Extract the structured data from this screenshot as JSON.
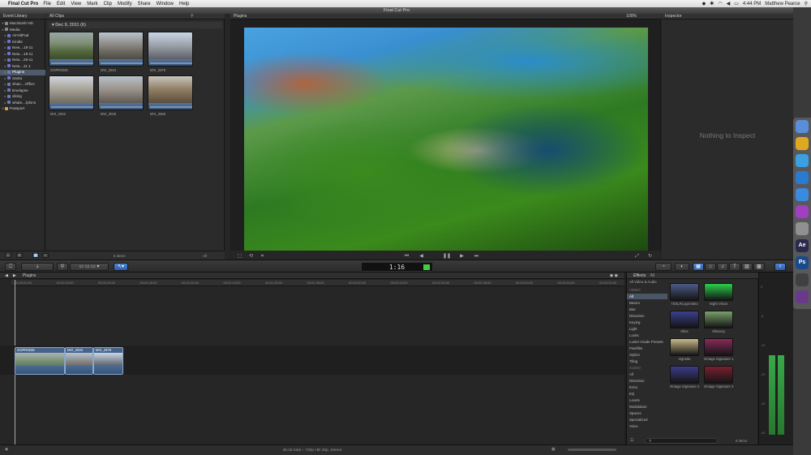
{
  "menubar": {
    "app_name": "Final Cut Pro",
    "items": [
      "File",
      "Edit",
      "View",
      "Mark",
      "Clip",
      "Modify",
      "Share",
      "Window",
      "Help"
    ],
    "time": "4:44 PM",
    "user": "Matthew Pearce"
  },
  "window_title": "Final Cut Pro",
  "event_library": {
    "title": "Event Library",
    "items": [
      {
        "label": "Macintosh HD",
        "icon": "disk-icon",
        "indent": 0,
        "selected": false
      },
      {
        "label": "Media",
        "icon": "disk-icon",
        "indent": 0,
        "selected": false
      },
      {
        "label": "AirVidPad",
        "icon": "event-icon",
        "indent": 1,
        "selected": false
      },
      {
        "label": "Kindle",
        "icon": "event-icon",
        "indent": 1,
        "selected": false
      },
      {
        "label": "New....18-11",
        "icon": "event-icon",
        "indent": 1,
        "selected": false
      },
      {
        "label": "New....19-11",
        "icon": "event-icon",
        "indent": 1,
        "selected": false
      },
      {
        "label": "New....25-11",
        "icon": "event-icon",
        "indent": 1,
        "selected": false
      },
      {
        "label": "New....11 1",
        "icon": "event-icon",
        "indent": 1,
        "selected": false
      },
      {
        "label": "Plugins",
        "icon": "event-icon",
        "indent": 1,
        "selected": true
      },
      {
        "label": "Santa",
        "icon": "event-icon",
        "indent": 1,
        "selected": false
      },
      {
        "label": "Shan....Office",
        "icon": "event-icon",
        "indent": 1,
        "selected": false
      },
      {
        "label": "timelapse",
        "icon": "event-icon",
        "indent": 1,
        "selected": false
      },
      {
        "label": "viking",
        "icon": "event-icon",
        "indent": 1,
        "selected": false
      },
      {
        "label": "whale....lphins",
        "icon": "event-icon",
        "indent": 1,
        "selected": false
      },
      {
        "label": "Passport",
        "icon": "drive-icon",
        "indent": 0,
        "selected": false
      }
    ]
  },
  "browser": {
    "title": "All Clips",
    "date_group": "Dec 9, 2011",
    "count": "(6)",
    "clips": [
      "GOPR0035",
      "MVI_2634",
      "MVI_2679",
      "MVI_2942",
      "MVI_3036",
      "MVI_3566"
    ],
    "footer_items": "6 items",
    "footer_filter": "All"
  },
  "viewer": {
    "title": "Plugins",
    "zoom": "100%"
  },
  "inspector": {
    "title": "Inspector",
    "empty_message": "Nothing to Inspect"
  },
  "toolbar": {
    "timecode": "1:16"
  },
  "timeline": {
    "project_name": "Plugins",
    "ruler_ticks": [
      "00:00:00:00",
      "00:00:15:00",
      "00:00:30:00",
      "00:00:45:00",
      "00:01:00:00",
      "00:01:15:00",
      "00:01:30:00",
      "00:01:45:00",
      "00:02:00:00",
      "00:02:15:00",
      "00:02:30:00",
      "00:02:45:00",
      "00:03:00:00",
      "00:03:15:00",
      "00:03:30:00"
    ],
    "clips": [
      "GOPR0035",
      "MVI_2634",
      "MVI_2679"
    ]
  },
  "effects": {
    "title": "Effects",
    "filter": "All Video & Audio",
    "categories": [
      {
        "label": "VIDEO",
        "heading": true,
        "selected": false
      },
      {
        "label": "All",
        "heading": false,
        "selected": true
      },
      {
        "label": "Basics",
        "heading": false,
        "selected": false
      },
      {
        "label": "Blur",
        "heading": false,
        "selected": false
      },
      {
        "label": "Distortion",
        "heading": false,
        "selected": false
      },
      {
        "label": "Keying",
        "heading": false,
        "selected": false
      },
      {
        "label": "Light",
        "heading": false,
        "selected": false
      },
      {
        "label": "Looks",
        "heading": false,
        "selected": false
      },
      {
        "label": "Luster Grade Presets",
        "heading": false,
        "selected": false
      },
      {
        "label": "Pixelfilm",
        "heading": false,
        "selected": false
      },
      {
        "label": "Stylize",
        "heading": false,
        "selected": false
      },
      {
        "label": "Tiling",
        "heading": false,
        "selected": false
      },
      {
        "label": "AUDIO",
        "heading": true,
        "selected": false
      },
      {
        "label": "All",
        "heading": false,
        "selected": false
      },
      {
        "label": "Distortion",
        "heading": false,
        "selected": false
      },
      {
        "label": "Echo",
        "heading": false,
        "selected": false
      },
      {
        "label": "EQ",
        "heading": false,
        "selected": false
      },
      {
        "label": "Levels",
        "heading": false,
        "selected": false
      },
      {
        "label": "Modulation",
        "heading": false,
        "selected": false
      },
      {
        "label": "Spaces",
        "heading": false,
        "selected": false
      },
      {
        "label": "Specialized",
        "heading": false,
        "selected": false
      },
      {
        "label": "Voice",
        "heading": false,
        "selected": false
      }
    ],
    "tiles": [
      {
        "label": "7DSLRLogoVideo",
        "color": "#4c5a88"
      },
      {
        "label": "Night Vision",
        "color": "#2bd04a"
      },
      {
        "label": "Olive",
        "color": "#3a3f8a"
      },
      {
        "label": "Vibrancy",
        "color": "#7a9f6a"
      },
      {
        "label": "Vignette",
        "color": "#c8b88a"
      },
      {
        "label": "Vintage Signature 1",
        "color": "#8a2a5a"
      },
      {
        "label": "Vintage Signature 2",
        "color": "#3c3c8c"
      },
      {
        "label": "Vintage Signature 3",
        "color": "#7a2030"
      }
    ],
    "footer_items": "8 items"
  },
  "meters": {
    "scale": [
      "0",
      "-6",
      "-12",
      "-20",
      "-30",
      "-50"
    ],
    "level_left": 0.53,
    "level_right": 0.53
  },
  "statusbar": {
    "text": "25:18 total – 720p HD 25p, Stereo"
  },
  "dock": [
    {
      "label": "",
      "icon": "finder-icon",
      "color": "#5b8ed8"
    },
    {
      "label": "",
      "icon": "chrome-icon",
      "color": "#e0a820"
    },
    {
      "label": "",
      "icon": "twitter-icon",
      "color": "#3aa0e0"
    },
    {
      "label": "",
      "icon": "appstore-icon",
      "color": "#2a7ad0"
    },
    {
      "label": "",
      "icon": "itunes-icon",
      "color": "#3a8adf"
    },
    {
      "label": "",
      "icon": "imovie-icon",
      "color": "#a040c0"
    },
    {
      "label": "",
      "icon": "aperture-icon",
      "color": "#909090"
    },
    {
      "label": "Ae",
      "icon": "after-effects-icon",
      "color": "#2a2a4a"
    },
    {
      "label": "Ps",
      "icon": "photoshop-icon",
      "color": "#1a4a8a"
    },
    {
      "label": "",
      "icon": "fcp-icon",
      "color": "#404040"
    },
    {
      "label": "",
      "icon": "motion-icon",
      "color": "#6a3a8a"
    }
  ]
}
